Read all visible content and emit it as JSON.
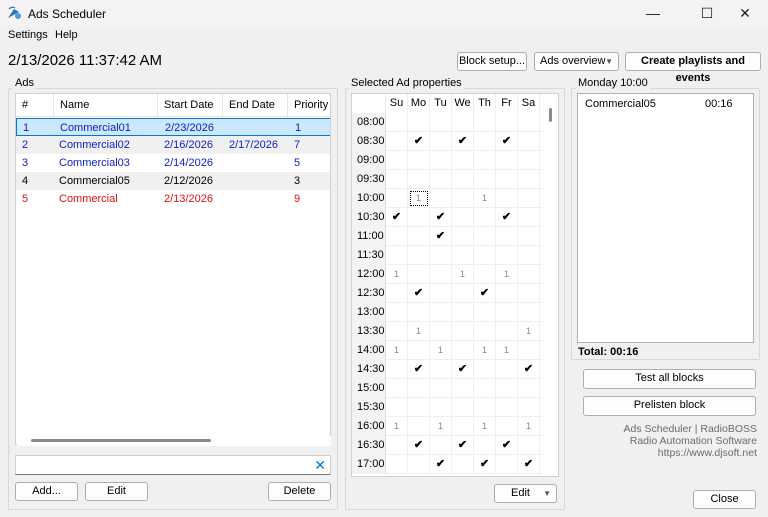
{
  "window": {
    "title": "Ads Scheduler",
    "minimize": "—",
    "maximize": "☐",
    "close": "✕"
  },
  "menu": [
    "Settings",
    "Help"
  ],
  "datetime": "2/13/2026 11:37:42 AM",
  "toolbar": {
    "block_setup": "Block setup...",
    "ads_overview": "Ads overview",
    "create": "Create playlists and events"
  },
  "ads_group": {
    "label": "Ads",
    "columns": [
      "#",
      "Name",
      "Start Date",
      "End Date",
      "Priority"
    ],
    "rows": [
      {
        "num": "1",
        "name": "Commercial01",
        "start": "2/23/2026",
        "end": "",
        "priority": "1",
        "style": "blue",
        "selected": true
      },
      {
        "num": "2",
        "name": "Commercial02",
        "start": "2/16/2026",
        "end": "2/17/2026",
        "priority": "7",
        "style": "blue",
        "selected": false
      },
      {
        "num": "3",
        "name": "Commercial03",
        "start": "2/14/2026",
        "end": "",
        "priority": "5",
        "style": "blue",
        "selected": false
      },
      {
        "num": "4",
        "name": "Commercial05",
        "start": "2/12/2026",
        "end": "",
        "priority": "3",
        "style": "black",
        "selected": false
      },
      {
        "num": "5",
        "name": "Commercial",
        "start": "2/13/2026",
        "end": "",
        "priority": "9",
        "style": "red",
        "selected": false
      }
    ],
    "search_value": "",
    "buttons": {
      "add": "Add...",
      "edit": "Edit",
      "delete": "Delete"
    }
  },
  "properties": {
    "label": "Selected Ad properties",
    "days": [
      "Su",
      "Mo",
      "Tu",
      "We",
      "Th",
      "Fr",
      "Sa"
    ],
    "rows": [
      {
        "time": "08:00",
        "cells": [
          "",
          "",
          "",
          "",
          "",
          "",
          ""
        ]
      },
      {
        "time": "08:30",
        "cells": [
          "",
          "check",
          "",
          "check",
          "",
          "check",
          ""
        ]
      },
      {
        "time": "09:00",
        "cells": [
          "",
          "",
          "",
          "",
          "",
          "",
          ""
        ]
      },
      {
        "time": "09:30",
        "cells": [
          "",
          "",
          "",
          "",
          "",
          "",
          ""
        ]
      },
      {
        "time": "10:00",
        "cells": [
          "",
          "1",
          "",
          "",
          "1",
          "",
          ""
        ],
        "focus": 1
      },
      {
        "time": "10:30",
        "cells": [
          "check",
          "",
          "check",
          "",
          "",
          "check",
          ""
        ]
      },
      {
        "time": "11:00",
        "cells": [
          "",
          "",
          "check",
          "",
          "",
          "",
          ""
        ]
      },
      {
        "time": "11:30",
        "cells": [
          "",
          "",
          "",
          "",
          "",
          "",
          ""
        ]
      },
      {
        "time": "12:00",
        "cells": [
          "1",
          "",
          "",
          "1",
          "",
          "1",
          ""
        ]
      },
      {
        "time": "12:30",
        "cells": [
          "",
          "check",
          "",
          "",
          "check",
          "",
          ""
        ]
      },
      {
        "time": "13:00",
        "cells": [
          "",
          "",
          "",
          "",
          "",
          "",
          ""
        ]
      },
      {
        "time": "13:30",
        "cells": [
          "",
          "1",
          "",
          "",
          "",
          "",
          "1"
        ]
      },
      {
        "time": "14:00",
        "cells": [
          "1",
          "",
          "1",
          "",
          "1",
          "1",
          ""
        ]
      },
      {
        "time": "14:30",
        "cells": [
          "",
          "check",
          "",
          "check",
          "",
          "",
          "check"
        ]
      },
      {
        "time": "15:00",
        "cells": [
          "",
          "",
          "",
          "",
          "",
          "",
          ""
        ]
      },
      {
        "time": "15:30",
        "cells": [
          "",
          "",
          "",
          "",
          "",
          "",
          ""
        ]
      },
      {
        "time": "16:00",
        "cells": [
          "1",
          "",
          "1",
          "",
          "1",
          "",
          "1"
        ]
      },
      {
        "time": "16:30",
        "cells": [
          "",
          "check",
          "",
          "check",
          "",
          "check",
          ""
        ]
      },
      {
        "time": "17:00",
        "cells": [
          "",
          "",
          "check",
          "",
          "check",
          "",
          "check"
        ]
      }
    ],
    "edit_button": "Edit"
  },
  "day_panel": {
    "label": "Monday 10:00",
    "items": [
      {
        "name": "Commercial05",
        "duration": "00:16"
      }
    ],
    "total": "Total: 00:16",
    "test_all": "Test all blocks",
    "prelisten": "Prelisten block"
  },
  "footer": {
    "line1": "Ads Scheduler | RadioBOSS",
    "line2": "Radio Automation Software",
    "line3": "https://www.djsoft.net"
  },
  "close_button": "Close"
}
